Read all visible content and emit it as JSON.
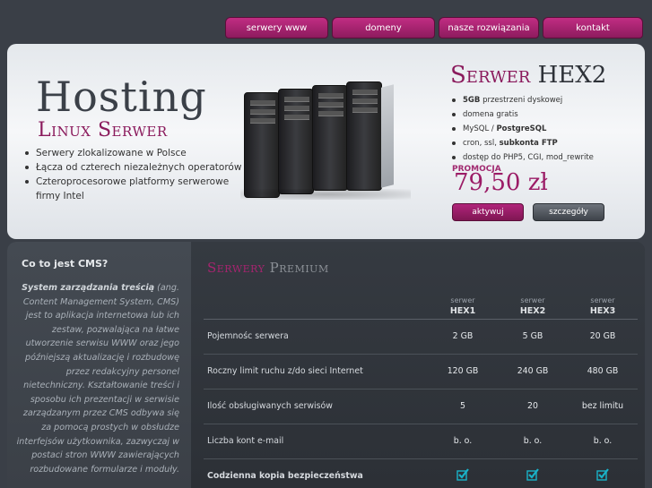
{
  "nav": [
    "serwery www",
    "domeny",
    "nasze rozwiązania",
    "kontakt"
  ],
  "banner": {
    "title": "Hosting",
    "subtitle": "Linux Serwer",
    "bullets": [
      "Serwery zlokalizowane w Polsce",
      "Łącza od czterech niezależnych operatorów",
      "Czteroprocesorowe platformy serwerowe firmy Intel"
    ],
    "offer_word1": "Serwer",
    "offer_word2": "HEX2",
    "offer_items": [
      {
        "bold": "5GB",
        "text": " przestrzeni dyskowej",
        "rest": ""
      },
      {
        "bold": "",
        "text": "domena gratis",
        "rest": ""
      },
      {
        "bold": "",
        "text": "MySQL / ",
        "rest": "PostgreSQL"
      },
      {
        "bold": "",
        "text": "cron, ssl, ",
        "rest": "subkonta FTP"
      },
      {
        "bold": "",
        "text": "dostęp do PHP5, CGI, mod_rewrite",
        "rest": ""
      }
    ],
    "promo_label": "PROMOCJA",
    "price": "79,50 zł",
    "activate_label": "aktywuj",
    "details_label": "szczegóły"
  },
  "sidebar": {
    "title": "Co to jest CMS?",
    "lead_bold": "System zarządzania treścią",
    "text": " (ang. Content Management System, CMS) jest to aplikacja internetowa lub ich zestaw, pozwalająca na łatwe utworzenie serwisu WWW oraz jego późniejszą aktualizację i rozbudowę przez redakcyjny personel nietechniczny. Kształtowanie treści i sposobu ich prezentacji w serwisie zarządzanym przez CMS odbywa się za pomocą prostych w obsłudze interfejsów użytkownika, zazwyczaj w postaci stron WWW zawierających rozbudowane formularze i moduły."
  },
  "main": {
    "title_word1": "Serwery",
    "title_word2": "Premium",
    "column_prefix": "serwer",
    "columns": [
      "HEX1",
      "HEX2",
      "HEX3"
    ],
    "rows": [
      {
        "label": "Pojemnośc serwera",
        "bold": false,
        "values": [
          "2 GB",
          "5 GB",
          "20 GB"
        ]
      },
      {
        "label": "Roczny limit ruchu z/do sieci Internet",
        "bold": false,
        "values": [
          "120 GB",
          "240 GB",
          "480 GB"
        ]
      },
      {
        "label": "Ilość obsługiwanych serwisów",
        "bold": false,
        "values": [
          "5",
          "20",
          "bez limitu"
        ]
      },
      {
        "label": "Liczba kont e-mail",
        "bold": false,
        "values": [
          "b. o.",
          "b. o.",
          "b. o."
        ]
      },
      {
        "label": "Codzienna kopia bezpieczeństwa",
        "bold": true,
        "values": [
          "check-icon",
          "check-icon",
          "check-icon"
        ]
      }
    ]
  },
  "colors": {
    "accent": "#8a1a5c",
    "check": "#19b3c9"
  }
}
